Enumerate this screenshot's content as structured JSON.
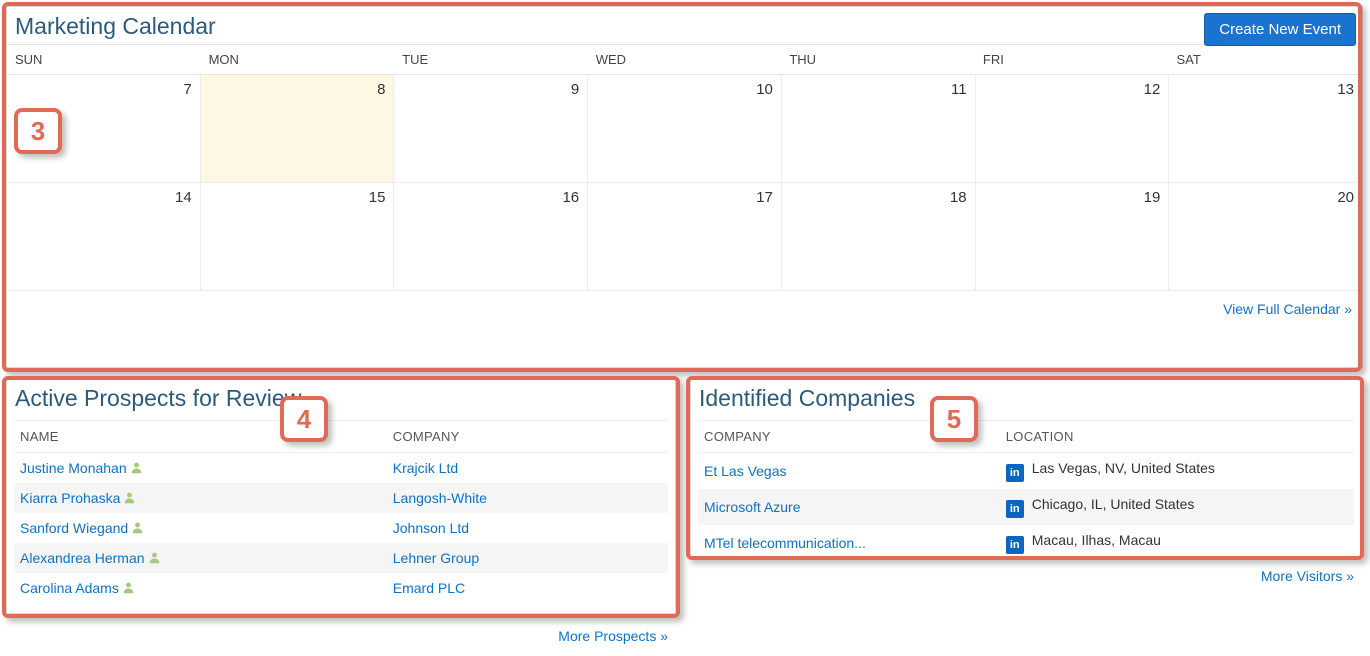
{
  "calendar": {
    "title": "Marketing Calendar",
    "create_label": "Create New Event",
    "view_full_label": "View Full Calendar »",
    "day_headers": [
      "SUN",
      "MON",
      "TUE",
      "WED",
      "THU",
      "FRI",
      "SAT"
    ],
    "weeks": [
      [
        {
          "num": "7",
          "today": false
        },
        {
          "num": "8",
          "today": true
        },
        {
          "num": "9",
          "today": false
        },
        {
          "num": "10",
          "today": false
        },
        {
          "num": "11",
          "today": false
        },
        {
          "num": "12",
          "today": false
        },
        {
          "num": "13",
          "today": false
        }
      ],
      [
        {
          "num": "14",
          "today": false
        },
        {
          "num": "15",
          "today": false
        },
        {
          "num": "16",
          "today": false
        },
        {
          "num": "17",
          "today": false
        },
        {
          "num": "18",
          "today": false
        },
        {
          "num": "19",
          "today": false
        },
        {
          "num": "20",
          "today": false
        }
      ]
    ]
  },
  "prospects": {
    "title": "Active Prospects for Review",
    "headers": {
      "name": "NAME",
      "company": "COMPANY"
    },
    "rows": [
      {
        "name": "Justine Monahan",
        "company": "Krajcik Ltd"
      },
      {
        "name": "Kiarra Prohaska",
        "company": "Langosh-White"
      },
      {
        "name": "Sanford Wiegand",
        "company": "Johnson Ltd"
      },
      {
        "name": "Alexandrea Herman",
        "company": "Lehner Group"
      },
      {
        "name": "Carolina Adams",
        "company": "Emard PLC"
      }
    ],
    "more_label": "More Prospects »"
  },
  "companies": {
    "title": "Identified Companies",
    "headers": {
      "company": "COMPANY",
      "location": "LOCATION"
    },
    "rows": [
      {
        "company": "Et Las Vegas",
        "location": "Las Vegas, NV, United States"
      },
      {
        "company": "Microsoft Azure",
        "location": "Chicago, IL, United States"
      },
      {
        "company": "MTel telecommunication...",
        "location": "Macau, Ilhas, Macau"
      }
    ],
    "more_label": "More Visitors »"
  },
  "annotations": {
    "badge3": "3",
    "badge4": "4",
    "badge5": "5"
  }
}
